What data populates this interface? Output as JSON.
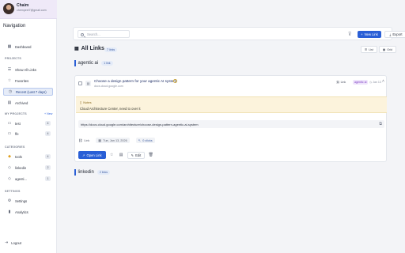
{
  "user": {
    "name": "Chaim",
    "email": "chempeel7@gmail.com"
  },
  "sidebar": {
    "title": "Navigation",
    "sections": {
      "projects": "PROJECTS",
      "my_projects": "MY PROJECTS",
      "categories": "CATEGORIES",
      "settings": "SETTINGS"
    },
    "new_label": "+ New",
    "items": {
      "dashboard": "Dashboard",
      "show_all": "Show All Links",
      "favorites": "Favorites",
      "recent": "Recent (Last 7 days)",
      "archived": "Archived",
      "settings": "Settings",
      "analytics": "Analytics"
    },
    "projects": [
      {
        "label": "test",
        "count": "4"
      },
      {
        "label": "ffe",
        "count": "4"
      }
    ],
    "categories": [
      {
        "label": "tools",
        "count": "4"
      },
      {
        "label": "linkedin",
        "count": "2"
      },
      {
        "label": "agenti...",
        "count": "1"
      }
    ],
    "logout": "Logout"
  },
  "toolbar": {
    "search_placeholder": "Search...",
    "new_link": "New Link",
    "export": "Export"
  },
  "header": {
    "title": "All Links",
    "count": "7 links",
    "view_list": "List",
    "view_grid": "Grid"
  },
  "groups": [
    {
      "name": "agentic ai",
      "count": "1 link"
    },
    {
      "name": "linkedin",
      "count": "2 links"
    }
  ],
  "card": {
    "title": "Choose a design pattern for your agentic AI system",
    "domain": "docs.cloud.google.com",
    "type_tag": "Link",
    "category_tag": "agentic ai",
    "date_short": "Jan 13",
    "notes_label": "Notes",
    "notes_text": "Cloud Architecture Center, need to over it",
    "url": "https://docs.cloud.google.com/architecture/choose-design-pattern-agentic-ai-system",
    "meta_type": "Link",
    "meta_date": "Tue, Jan 13, 2026",
    "meta_clicks": "0 clicks",
    "open_label": "Open Link",
    "edit_label": "Edit"
  },
  "colors": {
    "accent": "#2a5fd6",
    "sidebar_active": "#e6ecf8",
    "notes_bg": "#fcf3dc",
    "tag_ai_bg": "#efe4fb",
    "profile_bg": "#efe9f8"
  },
  "icons": {
    "dashboard": "layout-icon",
    "show_all": "list-icon",
    "favorites": "star-icon",
    "recent": "clock-icon",
    "archived": "archive-icon",
    "folder": "folder-icon",
    "settings": "gear-icon",
    "analytics": "bar-chart-icon",
    "logout": "logout-icon"
  }
}
